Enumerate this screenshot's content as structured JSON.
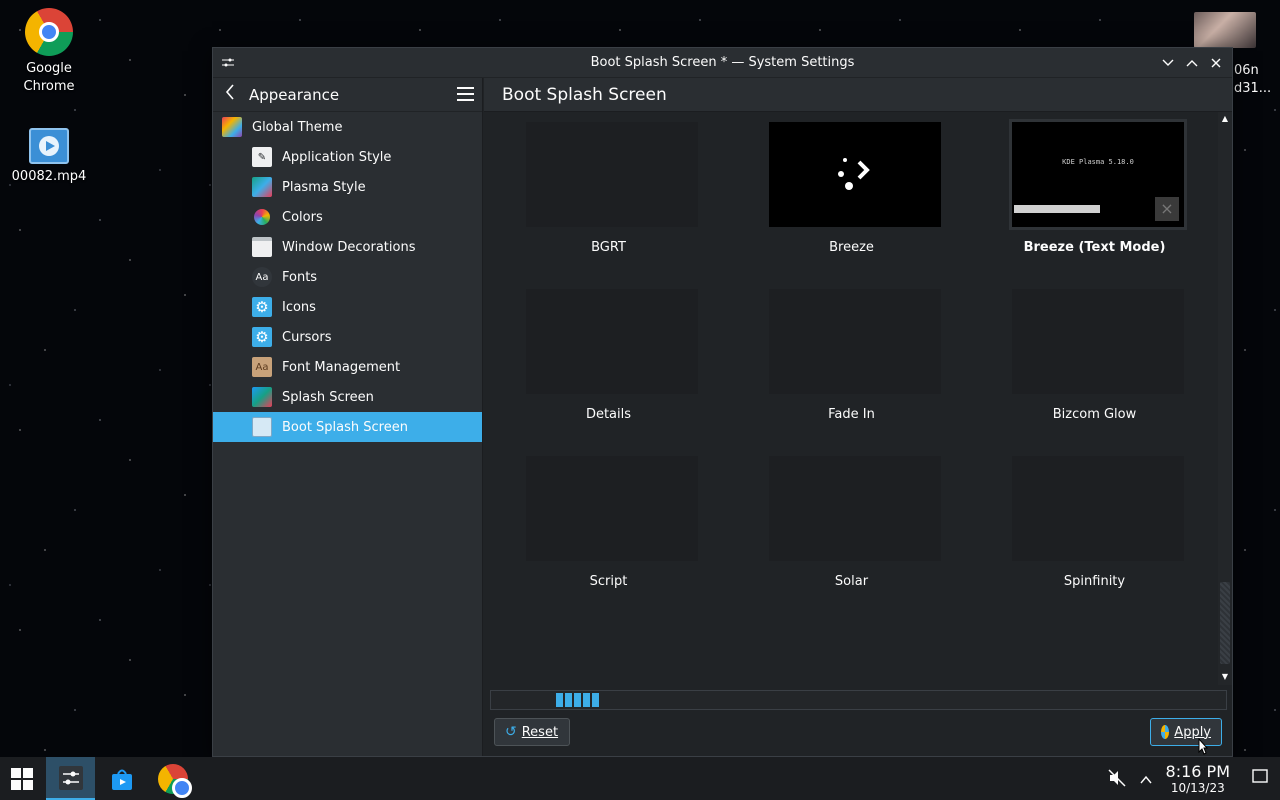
{
  "desktop": {
    "icons": [
      {
        "label": "Google\nChrome",
        "line1": "Google",
        "line2": "Chrome",
        "icon": "chrome-icon"
      },
      {
        "label": "00082.mp4",
        "icon": "video-file-icon"
      }
    ],
    "corner_text_1": "06n",
    "corner_text_2": "d31..."
  },
  "window": {
    "title": "Boot Splash Screen * — System Settings",
    "controls": [
      "minimize",
      "maximize",
      "close"
    ]
  },
  "sidebar": {
    "back_title": "Appearance",
    "items": [
      {
        "label": "Global Theme",
        "icon": "global-theme-icon",
        "level": 0,
        "active": false
      },
      {
        "label": "Application Style",
        "icon": "application-style-icon",
        "level": 1,
        "active": false
      },
      {
        "label": "Plasma Style",
        "icon": "plasma-style-icon",
        "level": 1,
        "active": false
      },
      {
        "label": "Colors",
        "icon": "colors-icon",
        "level": 1,
        "active": false
      },
      {
        "label": "Window Decorations",
        "icon": "window-decorations-icon",
        "level": 1,
        "active": false
      },
      {
        "label": "Fonts",
        "icon": "fonts-icon",
        "level": 1,
        "active": false
      },
      {
        "label": "Icons",
        "icon": "icons-gear-icon",
        "level": 1,
        "active": false
      },
      {
        "label": "Cursors",
        "icon": "cursors-gear-icon",
        "level": 1,
        "active": false
      },
      {
        "label": "Font Management",
        "icon": "font-management-icon",
        "level": 1,
        "active": false
      },
      {
        "label": "Splash Screen",
        "icon": "splash-screen-icon",
        "level": 1,
        "active": false
      },
      {
        "label": "Boot Splash Screen",
        "icon": "boot-splash-icon",
        "level": 1,
        "active": true
      }
    ]
  },
  "content": {
    "title": "Boot Splash Screen",
    "themes": [
      {
        "name": "BGRT",
        "preview": "none",
        "selected": false
      },
      {
        "name": "Breeze",
        "preview": "breeze",
        "selected": false
      },
      {
        "name": "Breeze (Text Mode)",
        "preview": "text-mode",
        "selected": true,
        "preview_text": "KDE Plasma 5.18.0"
      },
      {
        "name": "Details",
        "preview": "none",
        "selected": false
      },
      {
        "name": "Fade In",
        "preview": "none",
        "selected": false
      },
      {
        "name": "Bizcom Glow",
        "preview": "none",
        "selected": false
      },
      {
        "name": "Script",
        "preview": "none",
        "selected": false
      },
      {
        "name": "Solar",
        "preview": "none",
        "selected": false
      },
      {
        "name": "Spinfinity",
        "preview": "none",
        "selected": false
      }
    ],
    "busy_indicator": true
  },
  "footer": {
    "reset_label": "Reset",
    "apply_label": "Apply"
  },
  "taskbar": {
    "pinned": [
      "start-menu",
      "system-settings",
      "discover-store",
      "google-chrome"
    ],
    "active": "system-settings",
    "time": "8:16 PM",
    "date": "10/13/23"
  },
  "colors": {
    "accent": "#3daee9",
    "window_bg": "#202326",
    "sidebar_bg": "#2a2e32"
  }
}
